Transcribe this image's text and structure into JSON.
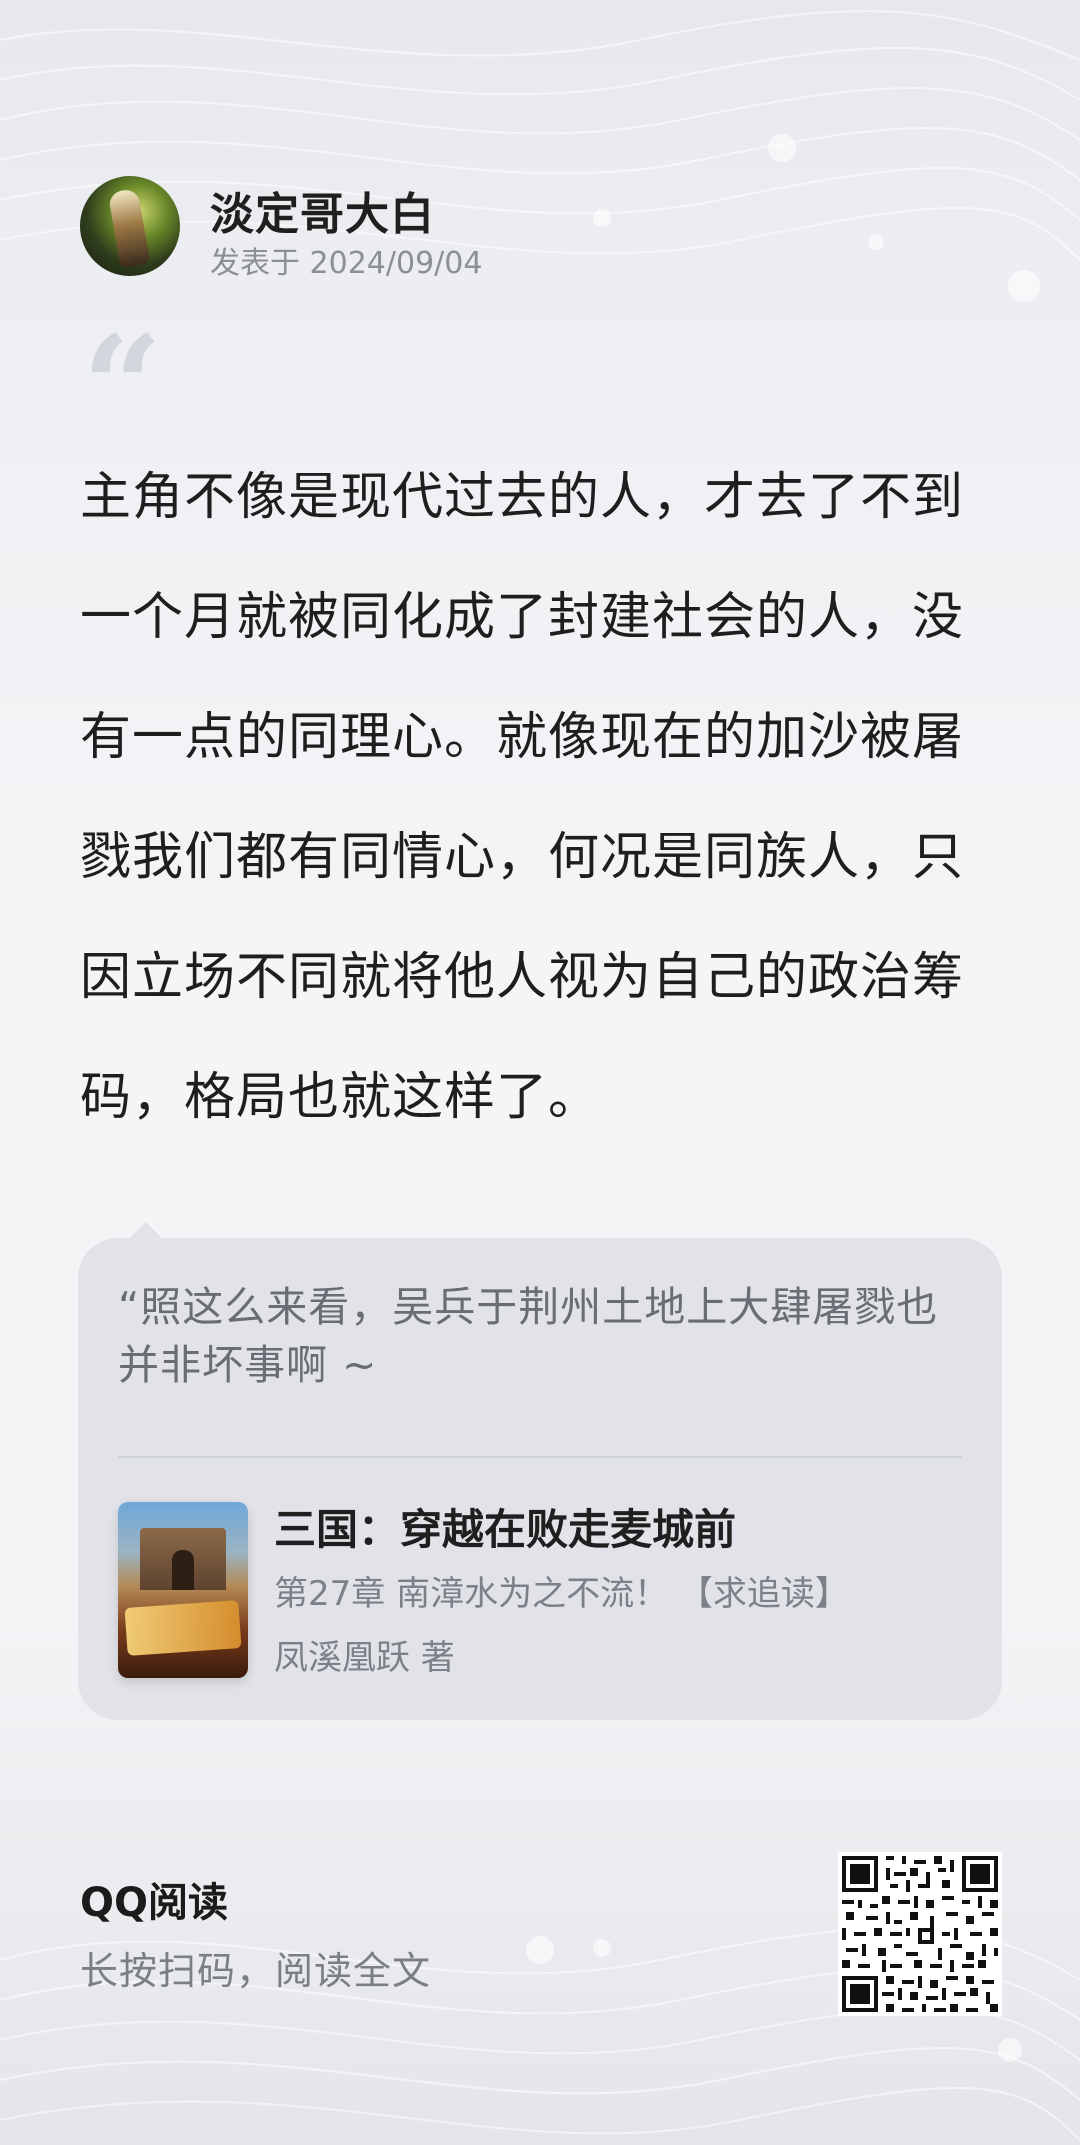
{
  "post": {
    "author_name": "淡定哥大白",
    "date": "发表于 2024/09/04",
    "quote_mark": "“",
    "comment_text": "主角不像是现代过去的人，才去了不到一个月就被同化成了封建社会的人，没有一点的同理心。就像现在的加沙被屠戮我们都有同情心，何况是同族人，只因立场不同就将他人视为自己的政治筹码，格局也就这样了。"
  },
  "excerpt_card": {
    "excerpt_text": "“照这么来看，吴兵于荆州土地上大肆屠戮也并非坏事啊 ~",
    "book": {
      "title": "三国：穿越在败走麦城前",
      "chapter": "第27章 南漳水为之不流！ 【求追读】",
      "author": "凤溪凰跃 著",
      "cover_icon": "book-cover-image"
    }
  },
  "footer": {
    "brand": "QQ阅读",
    "hint": "长按扫码，阅读全文",
    "qr_icon": "qr-code"
  },
  "colors": {
    "background": "#f2f3f5",
    "card": "#e1e3e9",
    "primary_text": "#1e1e1e",
    "secondary_text": "#8c8f96"
  }
}
